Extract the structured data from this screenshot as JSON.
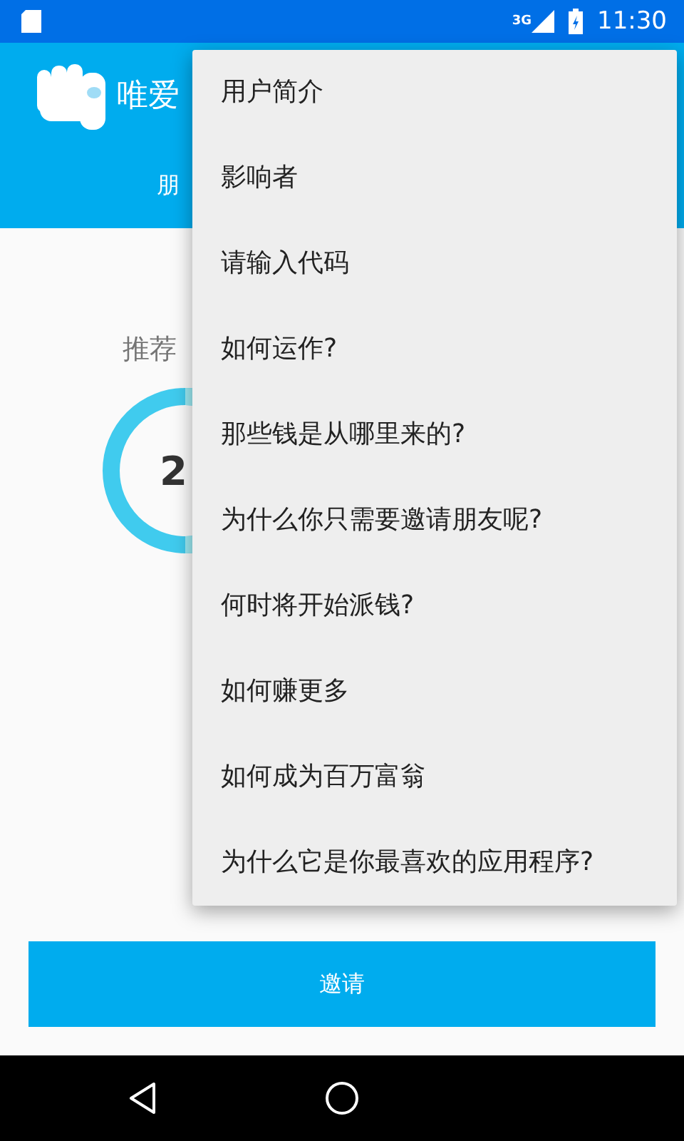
{
  "status_bar": {
    "network": "3G",
    "time": "11:30"
  },
  "app_bar": {
    "title": "唯爱",
    "tab": "朋"
  },
  "content": {
    "heading": "推荐",
    "count": "2"
  },
  "menu": {
    "items": [
      "用户简介",
      "影响者",
      "请输入代码",
      "如何运作?",
      "那些钱是从哪里来的?",
      "为什么你只需要邀请朋友呢?",
      "何时将开始派钱?",
      "如何赚更多",
      "如何成为百万富翁",
      "为什么它是你最喜欢的应用程序?"
    ]
  },
  "invite_button": "邀请"
}
